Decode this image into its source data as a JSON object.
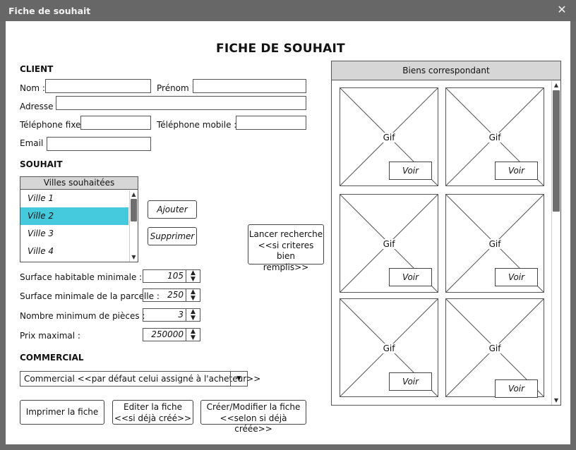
{
  "window": {
    "title": "Fiche de souhait",
    "close_glyph": "✕"
  },
  "form": {
    "heading": "FICHE DE SOUHAIT",
    "client": {
      "section": "CLIENT",
      "nom_label": "Nom :",
      "prenom_label": "Prénom :",
      "adresse_label": "Adresse :",
      "tel_fixe_label": "Téléphone fixe :",
      "tel_mobile_label": "Téléphone mobile :",
      "email_label": "Email :"
    },
    "souhait": {
      "section": "SOUHAIT",
      "villes_header": "Villes souhaitées",
      "villes": [
        "Ville 1",
        "Ville 2",
        "Ville 3",
        "Ville 4"
      ],
      "selected_ville": "Ville 2",
      "ajouter": "Ajouter",
      "supprimer": "Supprimer",
      "lancer_recherche": [
        "Lancer recherche",
        "<<si criteres bien",
        "remplis>>"
      ],
      "surface_habitable_label": "Surface habitable minimale :",
      "surface_habitable_value": "105",
      "surface_parcelle_label": "Surface minimale de la parcelle :",
      "surface_parcelle_value": "250",
      "pieces_label": "Nombre minimum de pièces :",
      "pieces_value": "3",
      "prix_label": "Prix maximal :",
      "prix_value": "250000"
    },
    "commercial": {
      "section": "COMMERCIAL",
      "selected": "Commercial <<par défaut celui assigné à l'acheteur>>"
    },
    "actions": {
      "imprimer": "Imprimer la fiche",
      "editer": [
        "Editer la fiche",
        "<<si déjà créé>>"
      ],
      "creer": [
        "Créer/Modifier la fiche",
        "<<selon si déjà créée>>"
      ]
    }
  },
  "biens": {
    "header": "Biens correspondant",
    "cards": [
      {
        "image_label": "Gif",
        "button": "Voir"
      },
      {
        "image_label": "Gif",
        "button": "Voir"
      },
      {
        "image_label": "Gif",
        "button": "Voir"
      },
      {
        "image_label": "Gif",
        "button": "Voir"
      },
      {
        "image_label": "Gif",
        "button": "Voir"
      },
      {
        "image_label": "Gif",
        "button": "Voir"
      }
    ]
  },
  "icons": {
    "scroll_up": "▲",
    "scroll_down": "▼",
    "dropdown": "▼",
    "spin_up": "▲",
    "spin_down": "▼"
  }
}
